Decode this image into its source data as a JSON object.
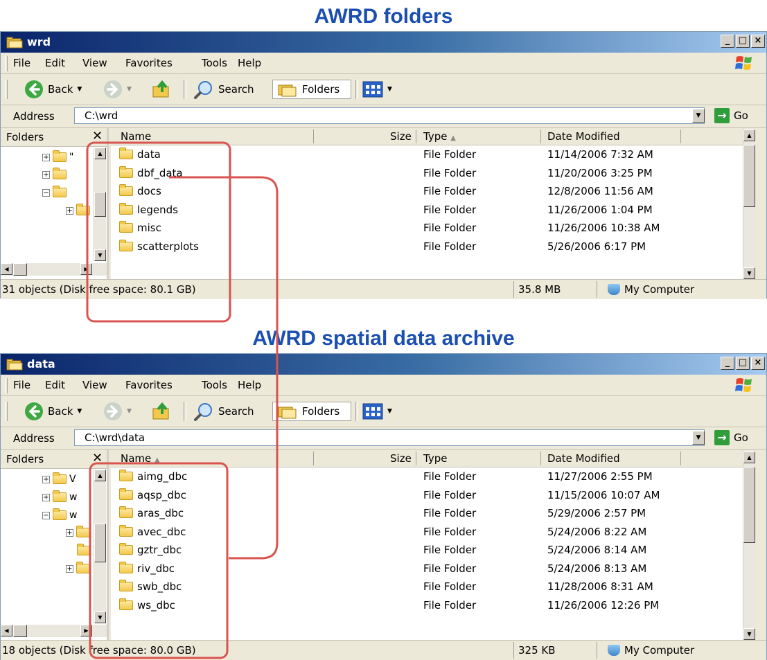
{
  "headings": {
    "top": "AWRD folders",
    "bottom": "AWRD spatial data archive"
  },
  "menu": [
    "File",
    "Edit",
    "View",
    "Favorites",
    "Tools",
    "Help"
  ],
  "toolbar": {
    "back": "Back",
    "search": "Search",
    "folders": "Folders"
  },
  "address": {
    "label": "Address",
    "go": "Go"
  },
  "panes": {
    "folders_title": "Folders",
    "close_glyph": "✕"
  },
  "columns": {
    "name": "Name",
    "size": "Size",
    "type": "Type",
    "date": "Date Modified"
  },
  "window1": {
    "title": "wrd",
    "path": "C:\\wrd",
    "rows": [
      {
        "name": "data",
        "type": "File Folder",
        "date": "11/14/2006 7:32 AM"
      },
      {
        "name": "dbf_data",
        "type": "File Folder",
        "date": "11/20/2006 3:25 PM"
      },
      {
        "name": "docs",
        "type": "File Folder",
        "date": "12/8/2006 11:56 AM"
      },
      {
        "name": "legends",
        "type": "File Folder",
        "date": "11/26/2006 1:04 PM"
      },
      {
        "name": "misc",
        "type": "File Folder",
        "date": "11/26/2006 10:38 AM"
      },
      {
        "name": "scatterplots",
        "type": "File Folder",
        "date": "5/26/2006 6:17 PM"
      }
    ],
    "tree": [
      "\"",
      "",
      "",
      ""
    ],
    "status": {
      "objects": "31 objects (Disk free space: 80.1 GB)",
      "size": "35.8 MB",
      "zone": "My Computer"
    }
  },
  "window2": {
    "title": "data",
    "path": "C:\\wrd\\data",
    "rows": [
      {
        "name": "aimg_dbc",
        "type": "File Folder",
        "date": "11/27/2006 2:55 PM"
      },
      {
        "name": "aqsp_dbc",
        "type": "File Folder",
        "date": "11/15/2006 10:07 AM"
      },
      {
        "name": "aras_dbc",
        "type": "File Folder",
        "date": "5/29/2006 2:57 PM"
      },
      {
        "name": "avec_dbc",
        "type": "File Folder",
        "date": "5/24/2006 8:22 AM"
      },
      {
        "name": "gztr_dbc",
        "type": "File Folder",
        "date": "5/24/2006 8:14 AM"
      },
      {
        "name": "riv_dbc",
        "type": "File Folder",
        "date": "5/24/2006 8:13 AM"
      },
      {
        "name": "swb_dbc",
        "type": "File Folder",
        "date": "11/28/2006 8:31 AM"
      },
      {
        "name": "ws_dbc",
        "type": "File Folder",
        "date": "11/26/2006 12:26 PM"
      }
    ],
    "tree": [
      "V",
      "w",
      "w"
    ],
    "status": {
      "objects": "18 objects (Disk free space: 80.0 GB)",
      "size": "325 KB",
      "zone": "My Computer"
    }
  },
  "colors": {
    "heading": "#1a4fb0",
    "annotation": "#d9534f"
  },
  "sort_indicator": "▲"
}
